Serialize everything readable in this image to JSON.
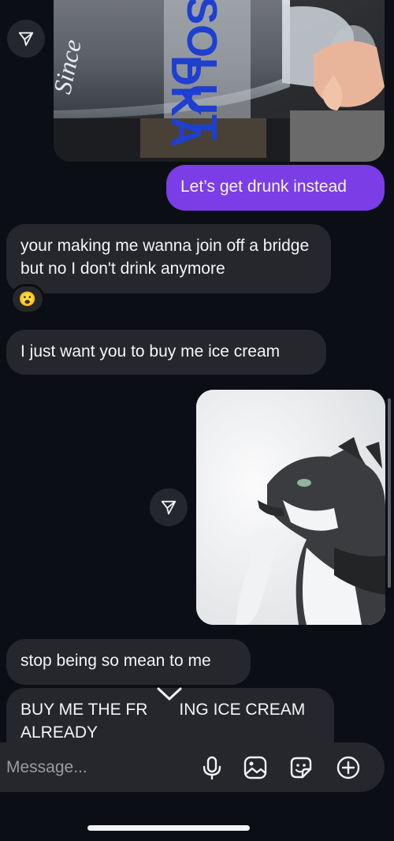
{
  "messages": {
    "sent_text_1": "Let’s get drunk instead",
    "recv_text_1": "your making me wanna join off a bridge but no I don't drink anymore",
    "recv_text_1_reaction": "😮",
    "recv_text_2": "I just want you to buy me ice cream",
    "recv_text_3": "stop being so mean to me",
    "recv_text_4_start": "BUY ME THE FR",
    "recv_text_4_end": "ING ICE CREAM",
    "recv_text_4_line2": "ALREADY"
  },
  "photo_1": {
    "bottle_brand": "SOLUT",
    "bottle_brand_2": "DKA",
    "bottle_script": "Since"
  },
  "composer": {
    "placeholder": "Message..."
  },
  "icons": {
    "share": "paper-plane-icon",
    "jump": "chevron-down-icon",
    "mic": "microphone-icon",
    "gallery": "image-icon",
    "sticker": "sticker-icon",
    "more": "plus-circle-icon"
  },
  "colors": {
    "background": "#0b0e14",
    "received_bubble": "#25272c",
    "sent_bubble": "#7a3de6",
    "text": "#f4f5f7"
  }
}
